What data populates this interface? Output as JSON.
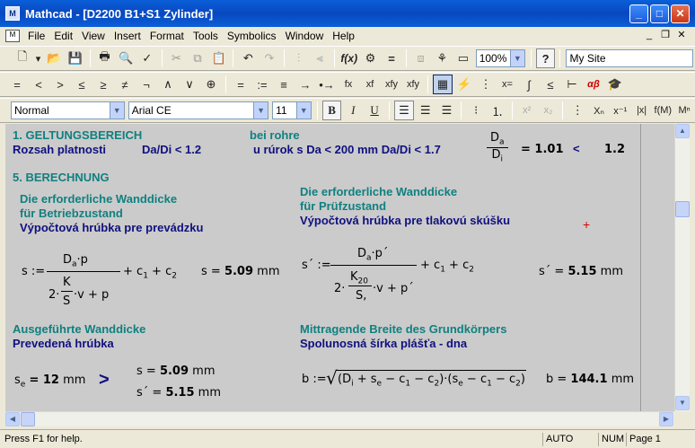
{
  "window": {
    "app_name": "Mathcad",
    "title": "Mathcad - [D2200 B1+S1 Zylinder]",
    "minimize": "_",
    "maximize": "□",
    "close": "✕"
  },
  "menu": {
    "items": [
      "File",
      "Edit",
      "View",
      "Insert",
      "Format",
      "Tools",
      "Symbolics",
      "Window",
      "Help"
    ]
  },
  "toolbar1": {
    "zoom": "100%",
    "resources": "My Site",
    "help_button": "?"
  },
  "toolbar2": {
    "operators": [
      "=",
      "<",
      ">",
      "≤",
      "≥",
      "≠",
      "¬",
      "∧",
      "∨",
      "⊕",
      "=",
      ":=",
      "≡",
      "→",
      "•→",
      "fx",
      "xf",
      "xfy",
      "xfy"
    ]
  },
  "toolbar3": {
    "style": "Normal",
    "font": "Arial CE",
    "size": "11",
    "bold": "B",
    "italic": "I",
    "underline": "U"
  },
  "document": {
    "line1_left": "1. GELTUNGSBEREICH",
    "line1_right": "bei rohre",
    "line2_left": "Rozsah platnosti",
    "line2_mid": "Da/Di < 1.2",
    "line2_right": "u rúrok s Da < 200 mm  Da/Di < 1.7",
    "ratio_num": "D",
    "ratio_num_sub": "a",
    "ratio_den": "D",
    "ratio_den_sub": "i",
    "ratio_result": "= 1.01",
    "ratio_lt": "<",
    "ratio_limit": "1.2",
    "section5": "5. BERECHNUNG",
    "left_h1": "Die erforderliche Wanddicke",
    "left_h2": "für Betriebzustand",
    "left_h3": "Výpočtová hrúbka pre prevádzku",
    "right_h1": "Die erforderliche Wanddicke",
    "right_h2": "für Prüfzustand",
    "right_h3": "Výpočtová hrúbka pre tlakovú skúšku",
    "s_def": "s :=",
    "s_num": "D",
    "s_num_sub": "a",
    "s_num_rest": "·p",
    "s_add": "+ c",
    "s_add_sub1": "1",
    "s_add2": " + c",
    "s_add_sub2": "2",
    "s_den_pre": "2·",
    "s_den_K": "K",
    "s_den_S": "S",
    "s_den_rest": "·v + p",
    "s_result_lhs": "s =",
    "s_result_val": "5.09",
    "s_result_unit": "mm",
    "sp_def": "s´ :=",
    "sp_num": "D",
    "sp_num_sub": "a",
    "sp_num_rest": "·p´",
    "sp_add": "+ c",
    "sp_add_sub1": "1",
    "sp_add2": " + c",
    "sp_add_sub2": "2",
    "sp_den_pre": "2·",
    "sp_den_K": "K",
    "sp_den_K_sub": "20",
    "sp_den_S": "S,",
    "sp_den_rest": "·v + p´",
    "sp_result_lhs": "s´ =",
    "sp_result_val": "5.15",
    "sp_result_unit": "mm",
    "exec_h1": "Ausgeführte Wanddicke",
    "exec_h2": "Prevedená hrúbka",
    "se_lhs": "s",
    "se_lhs_sub": "e",
    "se_eq": "= 12",
    "se_unit": "mm",
    "se_gt": ">",
    "cmp_s_lhs": "s =",
    "cmp_s_val": "5.09",
    "cmp_s_unit": "mm",
    "cmp_sp_lhs": "s´ =",
    "cmp_sp_val": "5.15",
    "cmp_sp_unit": "mm",
    "breite_h1": "Mittragende Breite des Grundkörpers",
    "breite_h2": "Spolunosná šírka plášťa - dna",
    "b_def": "b :=",
    "b_expr": "(D",
    "b_expr_sub1": "i",
    "b_expr2": " + s",
    "b_expr_sub2": "e",
    "b_expr3": " − c",
    "b_expr_sub3": "1",
    "b_expr4": " − c",
    "b_expr_sub4": "2",
    "b_expr5": ")·(s",
    "b_expr_sub5": "e",
    "b_expr6": " − c",
    "b_expr_sub6": "1",
    "b_expr7": " − c",
    "b_expr_sub7": "2",
    "b_expr8": ")",
    "b_result_lhs": "b =",
    "b_result_val": "144.1",
    "b_result_unit": "mm"
  },
  "status": {
    "help": "Press F1 for help.",
    "mode": "AUTO",
    "num": "NUM",
    "page": "Page 1"
  }
}
